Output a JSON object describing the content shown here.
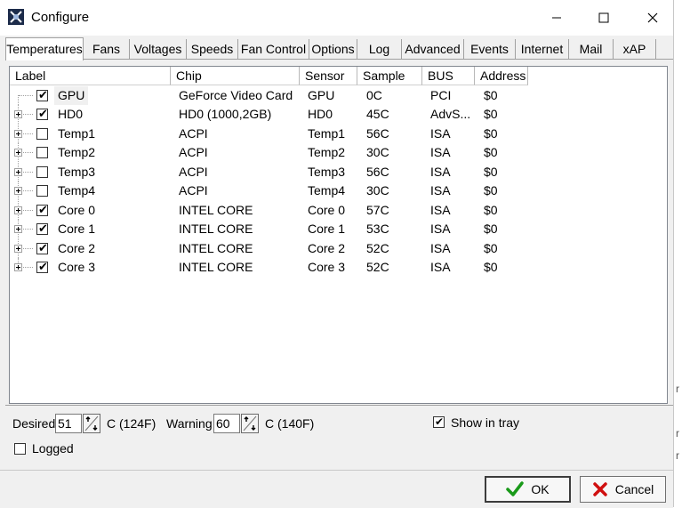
{
  "window": {
    "title": "Configure"
  },
  "tabs": [
    "Temperatures",
    "Fans",
    "Voltages",
    "Speeds",
    "Fan Control",
    "Options",
    "Log",
    "Advanced",
    "Events",
    "Internet",
    "Mail",
    "xAP"
  ],
  "active_tab": "Temperatures",
  "table": {
    "headers": [
      "Label",
      "Chip",
      "Sensor",
      "Sample",
      "BUS",
      "Address"
    ],
    "rows": [
      {
        "checked": true,
        "label": "GPU",
        "chip": "GeForce Video Card",
        "sensor": "GPU",
        "sample": "0C",
        "bus": "PCI",
        "address": "$0"
      },
      {
        "checked": true,
        "label": "HD0",
        "chip": "HD0 (1000,2GB)",
        "sensor": "HD0",
        "sample": "45C",
        "bus": "AdvS...",
        "address": "$0"
      },
      {
        "checked": false,
        "label": "Temp1",
        "chip": "ACPI",
        "sensor": "Temp1",
        "sample": "56C",
        "bus": "ISA",
        "address": "$0"
      },
      {
        "checked": false,
        "label": "Temp2",
        "chip": "ACPI",
        "sensor": "Temp2",
        "sample": "30C",
        "bus": "ISA",
        "address": "$0"
      },
      {
        "checked": false,
        "label": "Temp3",
        "chip": "ACPI",
        "sensor": "Temp3",
        "sample": "56C",
        "bus": "ISA",
        "address": "$0"
      },
      {
        "checked": false,
        "label": "Temp4",
        "chip": "ACPI",
        "sensor": "Temp4",
        "sample": "30C",
        "bus": "ISA",
        "address": "$0"
      },
      {
        "checked": true,
        "label": "Core 0",
        "chip": "INTEL CORE",
        "sensor": "Core 0",
        "sample": "57C",
        "bus": "ISA",
        "address": "$0"
      },
      {
        "checked": true,
        "label": "Core 1",
        "chip": "INTEL CORE",
        "sensor": "Core 1",
        "sample": "53C",
        "bus": "ISA",
        "address": "$0"
      },
      {
        "checked": true,
        "label": "Core 2",
        "chip": "INTEL CORE",
        "sensor": "Core 2",
        "sample": "52C",
        "bus": "ISA",
        "address": "$0"
      },
      {
        "checked": true,
        "label": "Core 3",
        "chip": "INTEL CORE",
        "sensor": "Core 3",
        "sample": "52C",
        "bus": "ISA",
        "address": "$0"
      }
    ]
  },
  "bottom": {
    "desired_label": "Desired",
    "desired_value": "51",
    "desired_unit": "C (124F)",
    "warning_label": "Warning",
    "warning_value": "60",
    "warning_unit": "C (140F)",
    "show_in_tray_label": "Show in tray",
    "show_in_tray_checked": true,
    "logged_label": "Logged",
    "logged_checked": false
  },
  "buttons": {
    "ok": "OK",
    "cancel": "Cancel"
  },
  "icons": {
    "app": "app-icon",
    "ok": "checkmark-icon",
    "cancel": "red-x-icon"
  },
  "colors": {
    "ok_icon": "#1a9a1a",
    "cancel_icon": "#d01010"
  }
}
